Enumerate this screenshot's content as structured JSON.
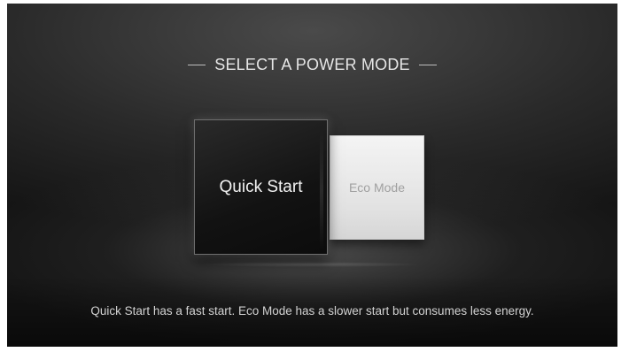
{
  "screen": {
    "title": "SELECT A POWER MODE",
    "options": [
      {
        "label": "Quick Start",
        "selected": true
      },
      {
        "label": "Eco Mode",
        "selected": false
      }
    ],
    "description": "Quick Start has a fast start.  Eco Mode has a slower start but consumes less energy."
  }
}
